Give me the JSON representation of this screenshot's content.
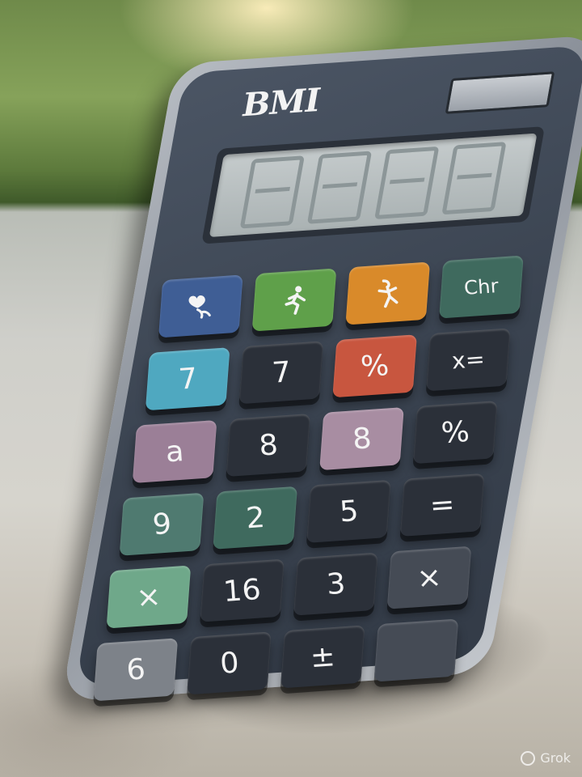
{
  "scene": {
    "description_colors": {
      "background_top": "#86a25a",
      "surface": "#d6d4cd",
      "calculator_body": "#3a4350"
    }
  },
  "calculator": {
    "brand": "BMI",
    "keys": [
      {
        "label": "",
        "icon": "heart-icon",
        "color": "#3f5e95"
      },
      {
        "label": "",
        "icon": "running-person-icon",
        "color": "#5fa04a"
      },
      {
        "label": "",
        "icon": "dancing-person-icon",
        "color": "#d98a2a"
      },
      {
        "label": "Chr",
        "icon": "",
        "color": "#3f6a5e"
      },
      {
        "label": "7",
        "icon": "",
        "color": "#4fa8c0"
      },
      {
        "label": "7",
        "icon": "",
        "color": "#2b3039"
      },
      {
        "label": "%",
        "icon": "",
        "color": "#c8563f"
      },
      {
        "label": "x=",
        "icon": "",
        "color": "#2b3039"
      },
      {
        "label": "a",
        "icon": "",
        "color": "#9b7f97"
      },
      {
        "label": "8",
        "icon": "",
        "color": "#2b3039"
      },
      {
        "label": "8",
        "icon": "",
        "color": "#a88da2"
      },
      {
        "label": "%",
        "icon": "",
        "color": "#2b3039"
      },
      {
        "label": "9",
        "icon": "",
        "color": "#4f7a70"
      },
      {
        "label": "2",
        "icon": "",
        "color": "#3f6a5e"
      },
      {
        "label": "5",
        "icon": "",
        "color": "#2b3039"
      },
      {
        "label": "=",
        "icon": "",
        "color": "#2b3039"
      },
      {
        "label": "×",
        "icon": "",
        "color": "#6fa88a"
      },
      {
        "label": "16",
        "icon": "",
        "color": "#2b3039"
      },
      {
        "label": "3",
        "icon": "",
        "color": "#2b3039"
      },
      {
        "label": "×",
        "icon": "",
        "color": "#454b55"
      },
      {
        "label": "6",
        "icon": "",
        "color": "#7d8289"
      },
      {
        "label": "0",
        "icon": "",
        "color": "#2b3039"
      },
      {
        "label": "±",
        "icon": "",
        "color": "#2b3039"
      },
      {
        "label": "",
        "icon": "",
        "color": "#454b55"
      }
    ]
  },
  "watermark": {
    "text": "Grok"
  }
}
